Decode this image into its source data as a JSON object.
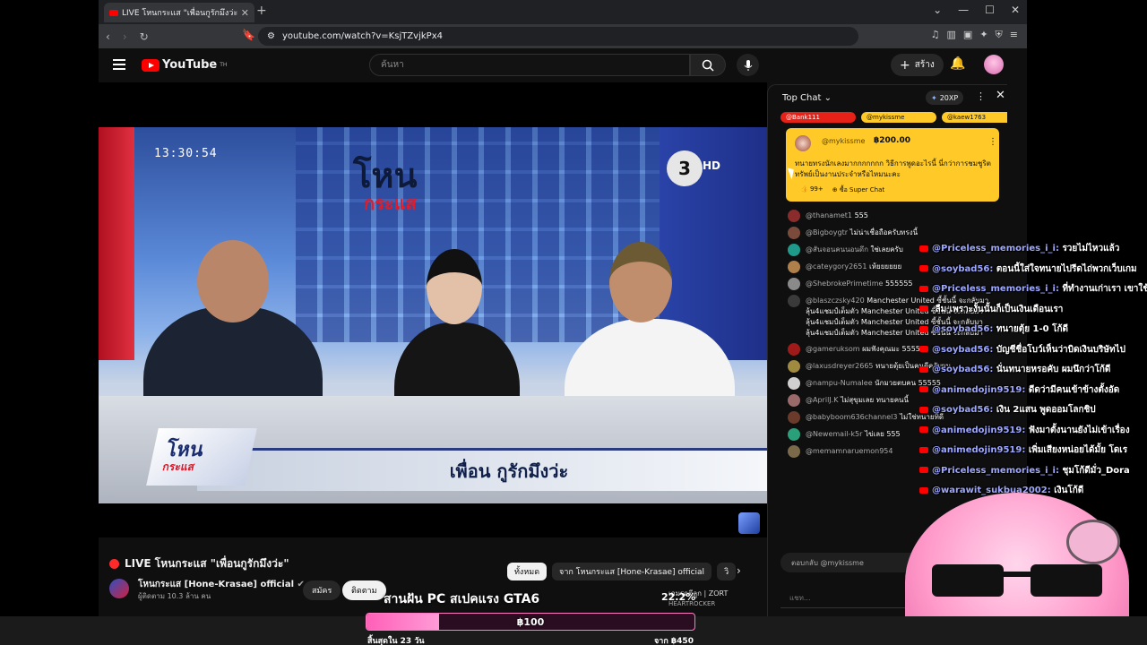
{
  "browser": {
    "tab_title": "LIVE โหนกระแส \"เพื่อนกูรักมึงว่ะ\"",
    "url": "youtube.com/watch?v=KsjTZvjkPx4"
  },
  "masthead": {
    "logo": "YouTube",
    "logo_sup": "TH",
    "search_placeholder": "ค้นหา",
    "create_label": "สร้าง"
  },
  "video": {
    "clock": "13:30:54",
    "show_logo_top": "โหน",
    "show_logo_bottom": "กระแส",
    "channel_num": "3",
    "hd_label": "HD",
    "banner_text": "เพื่อน กูรักมึงว่ะ",
    "title": "LIVE โหนกระแส \"เพื่อนกูรักมึงว่ะ\"",
    "channel_name": "โหนกระแส [Hone-Krasae] official",
    "subscribers": "ผู้ติดตาม 10.3 ล้าน คน",
    "join_label": "สมัคร",
    "subscribe_label": "ติดตาม"
  },
  "chips": [
    {
      "label": "ทั้งหมด",
      "active": true
    },
    {
      "label": "จาก โหนกระแส [Hone-Krasae] official",
      "active": false
    },
    {
      "label": "วิ",
      "active": false
    }
  ],
  "recommendation": {
    "title": "เกมรถตีลูก | ZORT",
    "channel": "HEARTROCKER"
  },
  "chat": {
    "mode": "Top Chat",
    "xp": "20XP",
    "ticker": [
      "@Bank111",
      "@mykissme",
      "@kaew1763"
    ],
    "superchat": {
      "author": "@mykissme",
      "amount": "฿200.00",
      "message": "ทนายทรงนักเลงมากกกกกกก วิธีการพูดอะไรนี้ นี่กว่าการชมชูริตทรัพย์เป็นงานประจำหรือไหมนะคะ",
      "likes": "99+",
      "super_chat": "ซื้อ Super Chat"
    },
    "messages": [
      {
        "author": "@thanamet1",
        "text": "555",
        "color": "#8a2c2c"
      },
      {
        "author": "@Bigboygtr",
        "text": "ไม่น่าเชื่อถือครับทรงนี้",
        "color": "#7a4b3a"
      },
      {
        "author": "@สันจอนคนนอนดึก",
        "text": "ใช่เลยครับ",
        "color": "#1f9a8a"
      },
      {
        "author": "@cateygory2651",
        "text": "เห้ยยยยยย",
        "color": "#b0804a"
      },
      {
        "author": "@ShebrokePrimetime",
        "text": "555555",
        "color": "#8a8a8a"
      },
      {
        "author": "@blaszczsky420",
        "text": "Manchester United ซี้ชั้นนี้ จะกลับมาลุ้น4แชมป์เต็มตัว Manchester United ซี้ชั้นนี้ จะกลับมาลุ้น4แชมป์เต็มตัว Manchester United ซี้ชั้นนี้ จะกลับมาลุ้น4แชมป์เต็มตัว Manchester United ซี้ชั้นนี้ จะกลับมา",
        "color": "#3a3a3a"
      },
      {
        "author": "@gameruksom",
        "text": "ผมฟังคุณมะ 5555",
        "color": "#a01a1a"
      },
      {
        "author": "@laxusdreyer2665",
        "text": "ทนายตุ้ยเป็นคนดีครับผม",
        "color": "#a08a40"
      },
      {
        "author": "@nampu-Numalee",
        "text": "นักมวยตบคน 55555",
        "color": "#d0d0d0"
      },
      {
        "author": "@AprilJ.K",
        "text": "ไม่สุขุมเลย ทนายคนนี้",
        "color": "#9a6a6a"
      },
      {
        "author": "@babyboom636channel3",
        "text": "ไม่ใช่ทนายที่ดี",
        "color": "#6a3a2a"
      },
      {
        "author": "@Newemail-k5r",
        "text": "ไข่เลย 555",
        "color": "#2aa07a"
      },
      {
        "author": "@memamnaruemon954",
        "text": "",
        "color": "#7a6a4a"
      }
    ],
    "reply_to": "ตอบกลับ @mykissme",
    "input_placeholder": "แชท..."
  },
  "overlay_chat": [
    {
      "user": "@Priceless_memories_i_i:",
      "text": "รวยไม่ไหวแล้ว"
    },
    {
      "user": "@soybad56:",
      "text": "ตอนนี้ใส่ใจทนายไปรีดไถ่พวกเว็บเกม"
    },
    {
      "user": "@Priceless_memories_i_i:",
      "text": "ที่ทำงานเก่าเรา เขาใช้"
    },
    {
      "user": "",
      "text": "ลืม เพราะงั้นนั้นก็เป็นเงินเดือนเรา"
    },
    {
      "user": "@soybad56:",
      "text": "ทนายตุ้ย 1-0 โก้ดี"
    },
    {
      "user": "@soybad56:",
      "text": "บัญชีชื่อโบว์เห็นว่าบิดเงินบริษัทไป"
    },
    {
      "user": "@soybad56:",
      "text": "นั่นทนายหรอคับ ผมนึกว่าโก้ดี"
    },
    {
      "user": "@animedojin9519:",
      "text": "ดีดว่ามีคนเข้าข้างตั้งอัด"
    },
    {
      "user": "@soybad56:",
      "text": "เงิน 2แสน พูดออมโลกชิป"
    },
    {
      "user": "@animedojin9519:",
      "text": "ฟังมาตั้งนานยังไม่เข้าเรื่อง"
    },
    {
      "user": "@animedojin9519:",
      "text": "เพิ่มเสียงหน่อยได้มั้ย โดเร"
    },
    {
      "user": "@Priceless_memories_i_i:",
      "text": "ชุมโก้ดีมั่ว_Dora"
    },
    {
      "user": "@warawit_sukbua2002:",
      "text": "เงินโก้ดี"
    }
  ],
  "donation_goal": {
    "title": "สานฝัน PC สเปคแรง GTA6",
    "percent": "22.2%",
    "fill_fraction": 0.222,
    "amount": "฿100",
    "left_label": "สิ้นสุดใน 23 วัน",
    "right_label": "จาก ฿450"
  },
  "colors": {
    "yt_red": "#ff0000",
    "superchat_yellow": "#ffca28",
    "overlay_user": "#9ea8ff",
    "goal_pink": "#ff5fb8"
  }
}
